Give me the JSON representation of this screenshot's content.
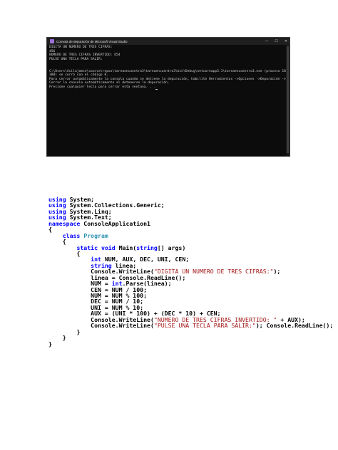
{
  "console": {
    "title": "Consola de depuración de Microsoft Visual Studio",
    "controls": {
      "minimize": "—",
      "maximize": "☐",
      "close": "✕"
    },
    "lines": [
      "DIGITA UN NUMERO DE TRES CIFRAS:",
      "456",
      "NUMERO DE TRES CIFRAS INVERTIDO: 654",
      "PULSE UNA TECLA PARA SALIR:",
      "",
      "",
      "C:\\Users\\Acilajomse\\source\\repos\\tareaencuentro3\\tareaencuentro3\\bin\\Debug\\netcoreapp3.1\\tareaencuentro3.exe (proceso 18",
      "388) se cerró con el código 0.",
      "Para cerrar automáticamente la consola cuando se detiene la depuración, habilite Herramientas ->Opciones ->Depuración ->",
      "Cerrar la consola automáticamente al detenerse la depuración.",
      "Presione cualquier tecla para cerrar esta ventana. . ."
    ]
  },
  "code": [
    {
      "indent": "",
      "tokens": [
        {
          "t": "using",
          "c": "kw"
        },
        {
          "t": " System;",
          "c": "txt"
        }
      ]
    },
    {
      "indent": "",
      "tokens": [
        {
          "t": "using",
          "c": "kw"
        },
        {
          "t": " System.Collections.Generic;",
          "c": "txt"
        }
      ]
    },
    {
      "indent": "",
      "tokens": [
        {
          "t": "using",
          "c": "kw"
        },
        {
          "t": " System.Linq;",
          "c": "txt"
        }
      ]
    },
    {
      "indent": "",
      "tokens": [
        {
          "t": "using",
          "c": "kw"
        },
        {
          "t": " System.Text;",
          "c": "txt"
        }
      ]
    },
    {
      "indent": "",
      "tokens": [
        {
          "t": "namespace",
          "c": "kw"
        },
        {
          "t": " ConsoleApplication1",
          "c": "txt"
        }
      ]
    },
    {
      "indent": "",
      "tokens": [
        {
          "t": "{",
          "c": "txt"
        }
      ]
    },
    {
      "indent": "    ",
      "tokens": [
        {
          "t": "class",
          "c": "kw"
        },
        {
          "t": " ",
          "c": "txt"
        },
        {
          "t": "Program",
          "c": "type"
        }
      ]
    },
    {
      "indent": "    ",
      "tokens": [
        {
          "t": "{",
          "c": "txt"
        }
      ]
    },
    {
      "indent": "        ",
      "tokens": [
        {
          "t": "static",
          "c": "kw"
        },
        {
          "t": " ",
          "c": "txt"
        },
        {
          "t": "void",
          "c": "kw"
        },
        {
          "t": " Main(",
          "c": "txt"
        },
        {
          "t": "string",
          "c": "kw"
        },
        {
          "t": "[] args)",
          "c": "txt"
        }
      ]
    },
    {
      "indent": "        ",
      "tokens": [
        {
          "t": "{",
          "c": "txt"
        }
      ]
    },
    {
      "indent": "            ",
      "tokens": [
        {
          "t": "int",
          "c": "kw"
        },
        {
          "t": " NUM, AUX, DEC, UNI, CEN;",
          "c": "txt"
        }
      ]
    },
    {
      "indent": "            ",
      "tokens": [
        {
          "t": "string",
          "c": "kw"
        },
        {
          "t": " linea;",
          "c": "txt"
        }
      ]
    },
    {
      "indent": "            ",
      "tokens": [
        {
          "t": "Console.WriteLine(",
          "c": "txt"
        },
        {
          "t": "\"DIGITA UN NUMERO DE TRES CIFRAS:\"",
          "c": "str"
        },
        {
          "t": ");",
          "c": "txt"
        }
      ]
    },
    {
      "indent": "            ",
      "tokens": [
        {
          "t": "linea = Console.ReadLine();",
          "c": "txt"
        }
      ]
    },
    {
      "indent": "            ",
      "tokens": [
        {
          "t": "NUM = ",
          "c": "txt"
        },
        {
          "t": "int",
          "c": "kw"
        },
        {
          "t": ".Parse(linea);",
          "c": "txt"
        }
      ]
    },
    {
      "indent": "            ",
      "tokens": [
        {
          "t": "CEN = NUM / 100;",
          "c": "txt"
        }
      ]
    },
    {
      "indent": "            ",
      "tokens": [
        {
          "t": "NUM = NUM % 100;",
          "c": "txt"
        }
      ]
    },
    {
      "indent": "            ",
      "tokens": [
        {
          "t": "DEC = NUM / 10;",
          "c": "txt"
        }
      ]
    },
    {
      "indent": "            ",
      "tokens": [
        {
          "t": "UNI = NUM % 10;",
          "c": "txt"
        }
      ]
    },
    {
      "indent": "            ",
      "tokens": [
        {
          "t": "AUX = (UNI * 100) + (DEC * 10) + CEN;",
          "c": "txt"
        }
      ]
    },
    {
      "indent": "            ",
      "tokens": [
        {
          "t": "Console.WriteLine(",
          "c": "txt"
        },
        {
          "t": "\"NUMERO DE TRES CIFRAS INVERTIDO: \"",
          "c": "str"
        },
        {
          "t": " + AUX);",
          "c": "txt"
        }
      ]
    },
    {
      "indent": "            ",
      "tokens": [
        {
          "t": "Console.WriteLine(",
          "c": "txt"
        },
        {
          "t": "\"PULSE UNA TECLA PARA SALIR:\"",
          "c": "str"
        },
        {
          "t": "); Console.ReadLine();",
          "c": "txt"
        }
      ]
    },
    {
      "indent": "        ",
      "tokens": [
        {
          "t": "}",
          "c": "txt"
        }
      ]
    },
    {
      "indent": "    ",
      "tokens": [
        {
          "t": "}",
          "c": "txt"
        }
      ]
    },
    {
      "indent": "",
      "tokens": [
        {
          "t": "}",
          "c": "txt"
        }
      ]
    }
  ]
}
